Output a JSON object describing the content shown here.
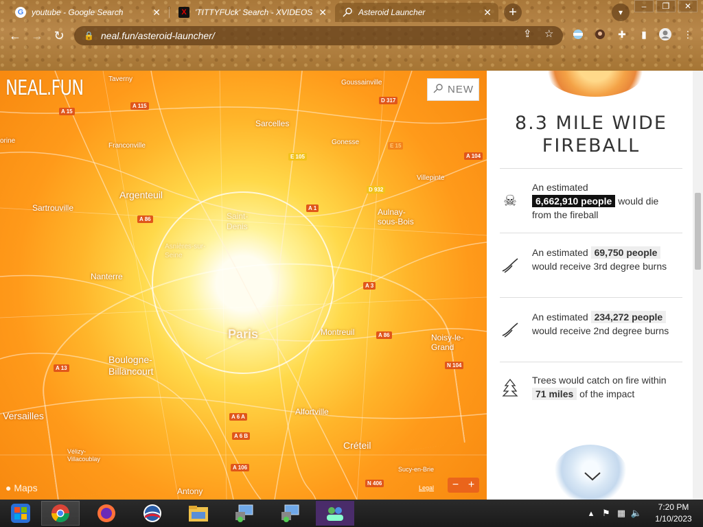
{
  "browser": {
    "tabs": [
      {
        "title": "youtube - Google Search",
        "favicon": "google-g-icon"
      },
      {
        "title": "'TITTYFUck' Search - XVIDEOS",
        "favicon": "x-logo-icon"
      },
      {
        "title": "Asteroid Launcher",
        "favicon": "asteroid-icon",
        "active": true
      }
    ],
    "url": "neal.fun/asteroid-launcher/",
    "new_tab": "+",
    "close_glyph": "✕"
  },
  "map": {
    "logo": "NEAL.FUN",
    "new_button": "NEW",
    "attribution": "Maps",
    "legal": "Legal",
    "labels": [
      {
        "text": "Taverny"
      },
      {
        "text": "Goussainville"
      },
      {
        "text": "Sarcelles"
      },
      {
        "text": "Franconville"
      },
      {
        "text": "Gonesse"
      },
      {
        "text": "Villepinte"
      },
      {
        "text": "Argenteuil"
      },
      {
        "text": "Sartrouville"
      },
      {
        "text": "Aulnay-sous-Bois"
      },
      {
        "text": "Saint-Denis"
      },
      {
        "text": "Asnières-sur-Seine"
      },
      {
        "text": "Nanterre"
      },
      {
        "text": "Paris"
      },
      {
        "text": "Montreuil"
      },
      {
        "text": "Noisy-le-Grand"
      },
      {
        "text": "Boulogne-Billancourt"
      },
      {
        "text": "Versailles"
      },
      {
        "text": "Alfortville"
      },
      {
        "text": "Créteil"
      },
      {
        "text": "Vélizy-Villacoublay"
      },
      {
        "text": "Antony"
      },
      {
        "text": "Sucy-en-Brie"
      },
      {
        "text": "orine"
      }
    ],
    "shields": [
      "A 15",
      "A 115",
      "D 317",
      "A 104",
      "N 104",
      "D 932",
      "A 86",
      "A 1",
      "A 3",
      "A 13",
      "A 86",
      "A 6 A",
      "A 6 B",
      "A 106",
      "N 406",
      "A 86",
      "E 15",
      "E 105"
    ]
  },
  "panel": {
    "title": "8.3 MILE WIDE FIREBALL",
    "stats": [
      {
        "icon": "skull-icon",
        "pre": "An estimated",
        "value": "6,662,910 people",
        "post": "would die from the fireball",
        "style": "dark"
      },
      {
        "icon": "burned-arm-icon",
        "pre": "An estimated",
        "value": "69,750 people",
        "post": "would receive 3rd degree burns",
        "style": "light"
      },
      {
        "icon": "burned-arm-icon",
        "pre": "An estimated",
        "value": "234,272 people",
        "post": "would receive 2nd degree burns",
        "style": "light"
      },
      {
        "icon": "tree-icon",
        "pre": "Trees would catch on fire within",
        "value": "71 miles",
        "post": "of the impact",
        "style": "light"
      }
    ]
  },
  "taskbar": {
    "apps": [
      "start-icon",
      "chrome-icon",
      "firefox-icon",
      "obama-logo-icon",
      "file-explorer-icon",
      "network-app-icon",
      "network-app-2-icon",
      "users-icon"
    ],
    "time": "7:20 PM",
    "date": "1/10/2023"
  }
}
